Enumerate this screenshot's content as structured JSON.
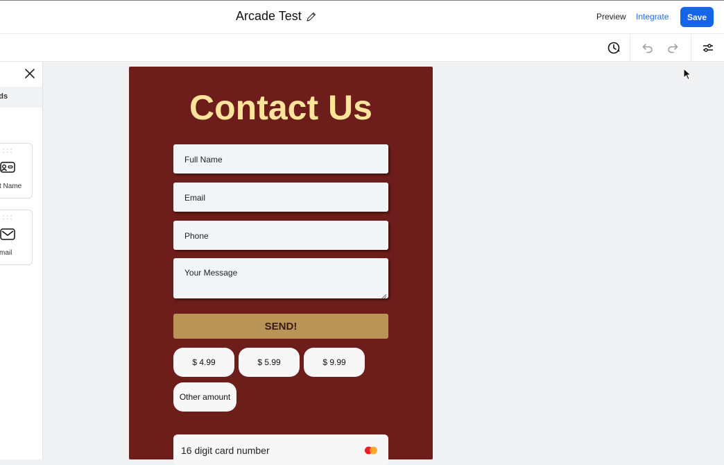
{
  "header": {
    "title": "Arcade Test",
    "preview_label": "Preview",
    "integrate_label": "Integrate",
    "save_label": "Save"
  },
  "sidebar": {
    "tab_label": "ields",
    "items": [
      {
        "label": "t Name",
        "icon": "name-field-icon"
      },
      {
        "label": "mail",
        "icon": "envelope-icon"
      }
    ]
  },
  "form": {
    "heading": "Contact Us",
    "fields": {
      "full_name": "Full Name",
      "email": "Email",
      "phone": "Phone",
      "message": "Your Message"
    },
    "send_label": "SEND!",
    "amounts": [
      "$  4.99",
      "$  5.99",
      "$  9.99",
      "Other amount"
    ],
    "card_placeholder": "16 digit card number"
  },
  "colors": {
    "accent": "#1565e8",
    "form_bg": "#6d1d1a",
    "heading": "#fde39b",
    "send_button": "#b89456"
  }
}
